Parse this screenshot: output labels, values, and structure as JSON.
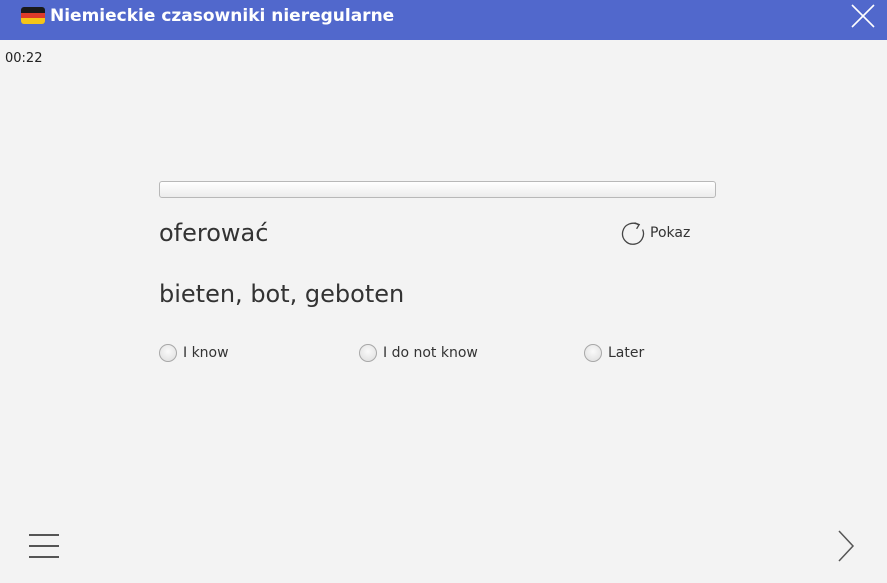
{
  "header": {
    "title": "Niemieckie czasowniki nieregularne",
    "flag_icon": "german-flag-icon",
    "flag_colors": [
      "#1a1a1a",
      "#dd3b2a",
      "#f5c518"
    ],
    "close_icon": "close-icon",
    "background": "#5168cc"
  },
  "timer": "00:22",
  "progress": {
    "fraction": 0
  },
  "card": {
    "word": "oferować",
    "answer": "bieten, bot, geboten",
    "show_label": "Pokaz",
    "show_icon": "refresh-icon"
  },
  "options": [
    {
      "label": "I know"
    },
    {
      "label": "I do not know"
    },
    {
      "label": "Later"
    }
  ],
  "footer": {
    "menu_icon": "hamburger-menu-icon",
    "next_icon": "chevron-right-icon"
  }
}
